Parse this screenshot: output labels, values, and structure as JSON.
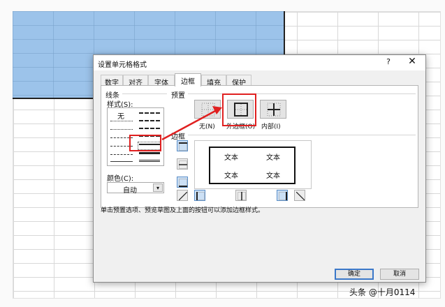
{
  "dialog": {
    "title": "设置单元格格式",
    "help": "?",
    "close": "✕",
    "tabs": [
      "数字",
      "对齐",
      "字体",
      "边框",
      "填充",
      "保护"
    ],
    "active_tab": "边框"
  },
  "line_group": {
    "label": "线条",
    "style_label": "样式(S):",
    "none_label": "无",
    "color_label": "颜色(C):",
    "color_value": "自动"
  },
  "presets": {
    "label": "预置",
    "items": [
      {
        "label": "无(N)"
      },
      {
        "label": "外边框(O)"
      },
      {
        "label": "内部(I)"
      }
    ]
  },
  "border_group": {
    "label": "边框",
    "preview_texts": [
      "文本",
      "文本",
      "文本",
      "文本"
    ]
  },
  "hint": "单击预置选项、预览草图及上面的按钮可以添加边框样式。",
  "buttons": {
    "ok": "确定",
    "cancel": "取消"
  },
  "watermark": "头条 @十月0114",
  "colors": {
    "highlight": "#e02020",
    "selection": "#9cc3ea"
  }
}
